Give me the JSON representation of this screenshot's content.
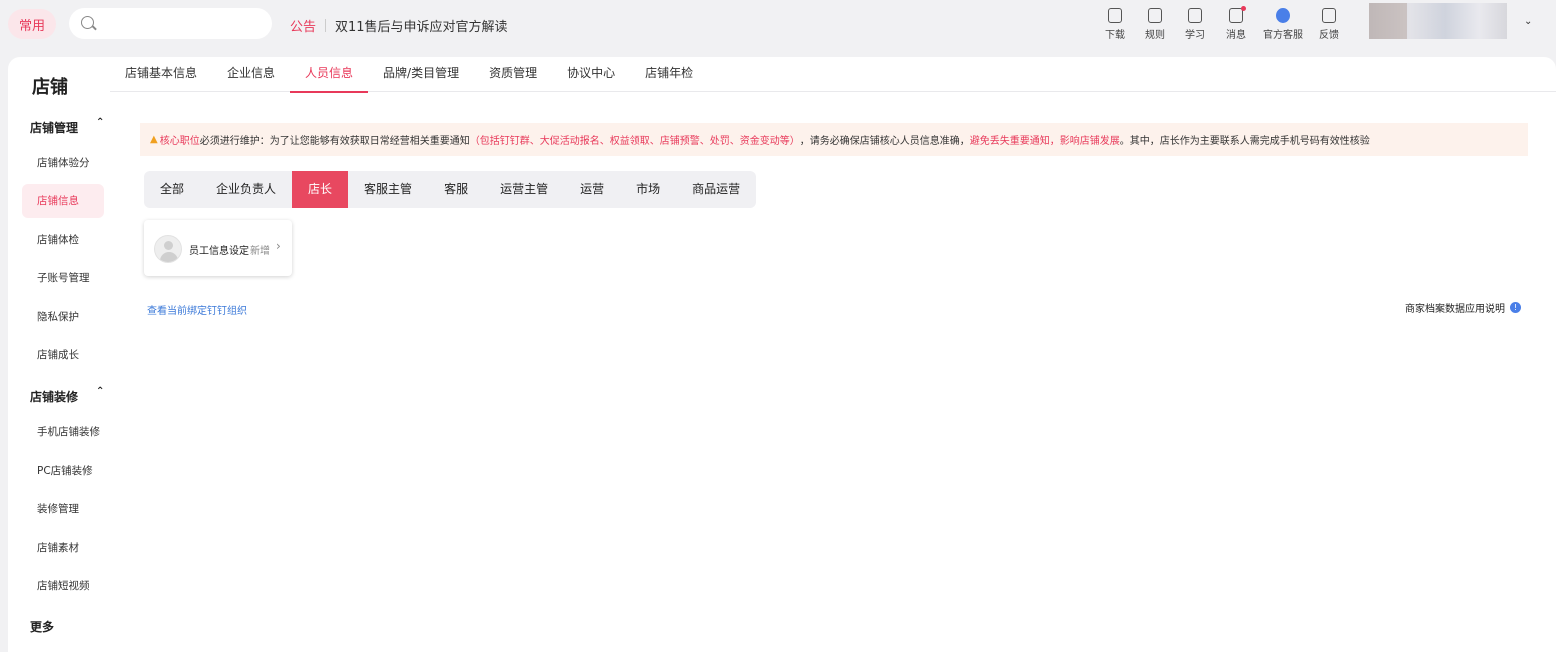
{
  "header": {
    "common_label": "常用",
    "search_placeholder": "",
    "notice_tag": "公告",
    "notice_text": "双11售后与申诉应对官方解读",
    "tools": [
      {
        "label": "下载",
        "icon": "download-icon"
      },
      {
        "label": "规则",
        "icon": "rules-icon"
      },
      {
        "label": "学习",
        "icon": "learn-icon"
      },
      {
        "label": "消息",
        "icon": "message-icon",
        "badge": true
      },
      {
        "label": "官方客服",
        "icon": "customer-service-icon"
      },
      {
        "label": "反馈",
        "icon": "feedback-icon"
      }
    ],
    "caret": "⌄"
  },
  "sidebar": {
    "title": "店铺",
    "groups": [
      {
        "label": "店铺管理",
        "chevron": "⌃"
      },
      {
        "label": "店铺装修",
        "chevron": "⌃"
      },
      {
        "label": "更多"
      }
    ],
    "items": [
      {
        "label": "店铺体验分"
      },
      {
        "label": "店铺信息"
      },
      {
        "label": "店铺体检"
      },
      {
        "label": "子账号管理"
      },
      {
        "label": "隐私保护"
      },
      {
        "label": "店铺成长"
      },
      {
        "label": "手机店铺装修"
      },
      {
        "label": "PC店铺装修"
      },
      {
        "label": "装修管理"
      },
      {
        "label": "店铺素材"
      },
      {
        "label": "店铺短视频"
      }
    ]
  },
  "tabs": [
    "店铺基本信息",
    "企业信息",
    "人员信息",
    "品牌/类目管理",
    "资质管理",
    "协议中心",
    "店铺年检"
  ],
  "alert": {
    "icon": "warning-icon",
    "part1": "核心职位",
    "part2": "必须进行维护：为了让您能够有效获取日常经营相关重要通知",
    "part3": "（包括钉钉群、大促活动报名、权益领取、店铺预警、处罚、资金变动等）",
    "part4": "，请务必确保店铺核心人员信息准确，",
    "part5": "避免丢失重要通知，影响店铺发展",
    "part6": "。其中，店长作为主要联系人需完成手机号码有效性核验"
  },
  "roles": [
    "全部",
    "企业负责人",
    "店长",
    "客服主管",
    "客服",
    "运营主管",
    "运营",
    "市场",
    "商品运营"
  ],
  "staff_card": {
    "label": "员工信息设定",
    "action": "新增",
    "arrow": "›"
  },
  "links": {
    "dingtalk": "查看当前绑定钉钉组织",
    "doc": "商家档案数据应用说明",
    "doc_icon": "!"
  },
  "colors": {
    "accent": "#e8395a",
    "link": "#3a78d8"
  }
}
